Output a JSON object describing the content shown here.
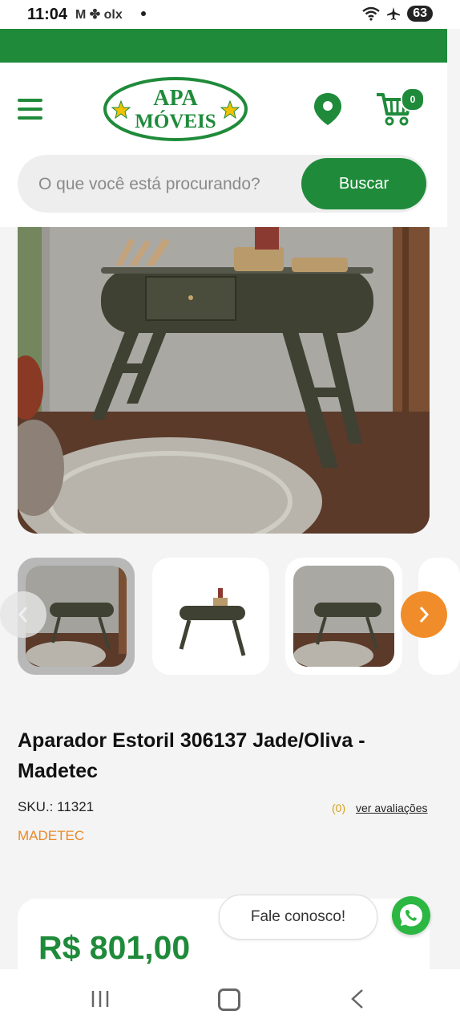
{
  "status_bar": {
    "time": "11:04",
    "notifications": "M ✤ olx",
    "battery": "63"
  },
  "header": {
    "logo_line1": "APA",
    "logo_line2": "MÓVEIS",
    "cart_count": "0"
  },
  "search": {
    "placeholder": "O que você está procurando?",
    "button_label": "Buscar"
  },
  "product": {
    "title": "Aparador Estoril 306137 Jade/Oliva - Madetec",
    "sku": "SKU.: 11321",
    "reviews_count": "(0)",
    "reviews_link": "ver avaliações",
    "brand": "MADETEC",
    "price": "R$ 801,00"
  },
  "chat": {
    "label": "Fale conosco!"
  },
  "colors": {
    "brand_green": "#1f8b3a",
    "accent_orange": "#f08d2a",
    "whatsapp_green": "#2bb741"
  }
}
